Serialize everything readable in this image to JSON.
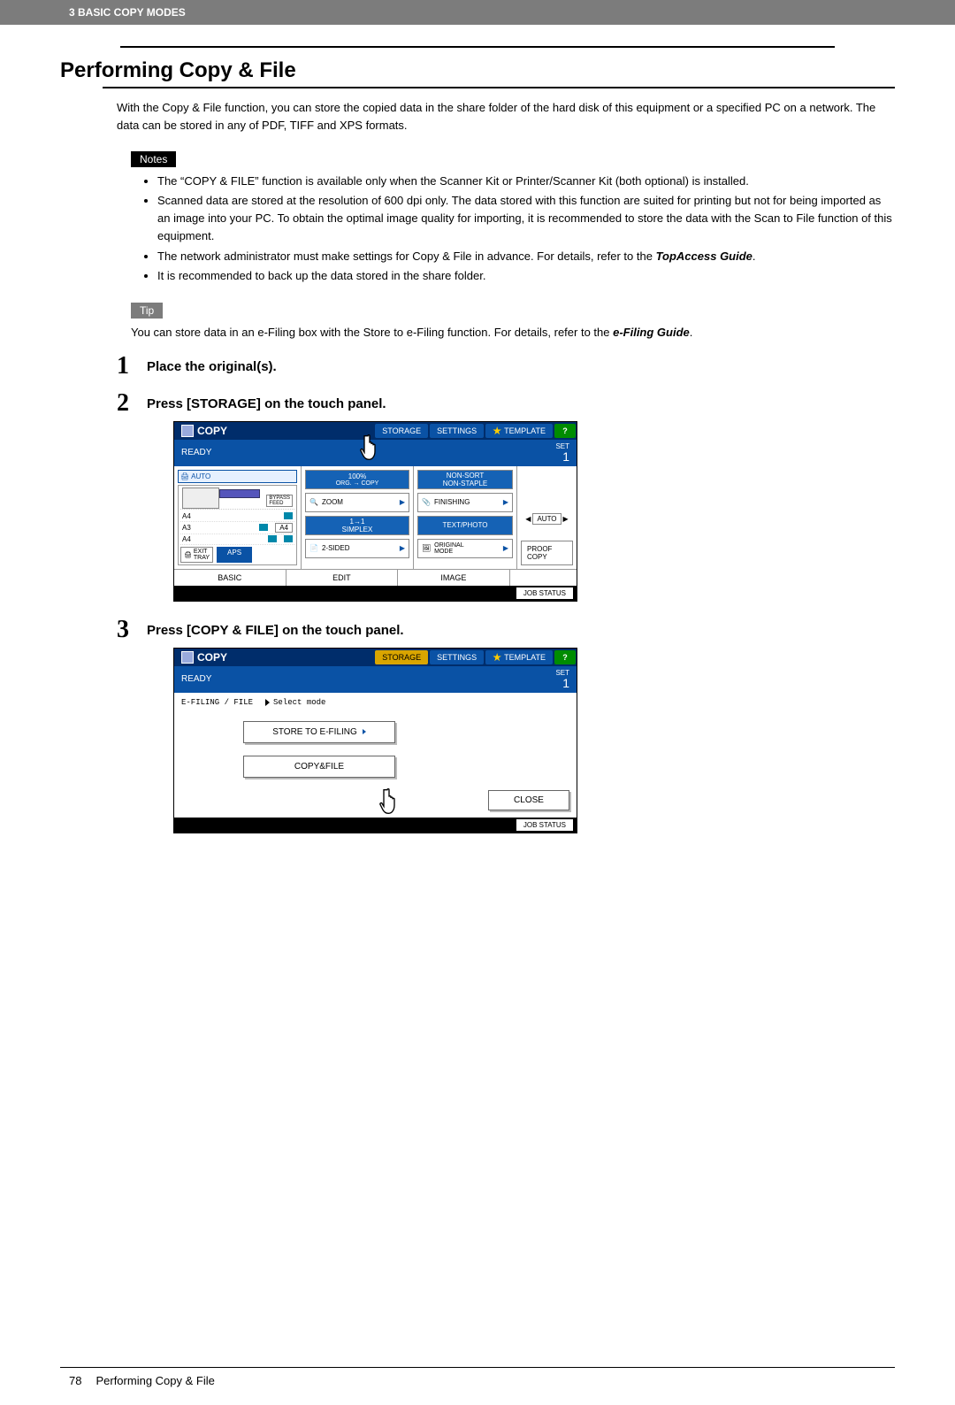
{
  "header": {
    "chapter": "3 BASIC COPY MODES"
  },
  "title": "Performing Copy & File",
  "intro": "With the Copy & File function, you can store the copied data in the share folder of the hard disk of this equipment or a specified PC on a network. The data can be stored in any of PDF, TIFF and XPS formats.",
  "notes": {
    "label": "Notes",
    "items": [
      "The “COPY & FILE” function is available only when the Scanner Kit or Printer/Scanner Kit (both optional) is installed.",
      "Scanned data are stored at the resolution of 600 dpi only. The data stored with this function are suited for printing but not for being imported as an image into your PC. To obtain the optimal image quality for importing, it is recommended to store the data with the Scan to File function of this equipment.",
      "The network administrator must make settings for Copy & File in advance. For details, refer to the ",
      "It is recommended to back up the data stored in the share folder."
    ],
    "topaccess": "TopAccess Guide"
  },
  "tip": {
    "label": "Tip",
    "text_prefix": "You can store data in an e-Filing box with the Store to e-Filing function. For details, refer to the ",
    "ref": "e-Filing Guide",
    "text_suffix": "."
  },
  "steps": {
    "s1": {
      "num": "1",
      "text": "Place the original(s)."
    },
    "s2": {
      "num": "2",
      "text": "Press [STORAGE] on the touch panel."
    },
    "s3": {
      "num": "3",
      "text": "Press [COPY & FILE] on the touch panel."
    }
  },
  "panel": {
    "copy_label": "COPY",
    "tabs": {
      "storage": "STORAGE",
      "settings": "SETTINGS",
      "template": "TEMPLATE",
      "help": "?"
    },
    "ready": "READY",
    "set": "SET",
    "set_num": "1",
    "auto": "AUTO",
    "bypass": "BYPASS\nFEED",
    "trays": {
      "a4_1": "A4",
      "a3": "A3",
      "a4_2": "A4",
      "a4_side": "A4"
    },
    "exit_tray": "EXIT\nTRAY",
    "aps": "APS",
    "mid": {
      "pct": "100%",
      "org_copy": "ORG. → COPY",
      "zoom": "ZOOM",
      "simplex": "1→1\nSIMPLEX",
      "twosided": "2-SIDED"
    },
    "right1": {
      "nonsort": "NON-SORT\nNON-STAPLE",
      "finishing": "FINISHING",
      "textphoto": "TEXT/PHOTO",
      "original": "ORIGINAL\nMODE"
    },
    "right2": {
      "density_arrows": {
        "left": "◀",
        "right": "▶"
      },
      "density_auto": "AUTO",
      "proof": "PROOF COPY"
    },
    "bottom_tabs": {
      "basic": "BASIC",
      "edit": "EDIT",
      "image": "IMAGE"
    },
    "jobstatus": "JOB STATUS"
  },
  "panel3": {
    "efile_label": "E-FILING / FILE",
    "select_mode": "Select mode",
    "store_btn": "STORE TO E-FILING",
    "copyfile_btn": "COPY&FILE",
    "close": "CLOSE"
  },
  "footer": {
    "page": "78",
    "title": "Performing Copy & File"
  }
}
